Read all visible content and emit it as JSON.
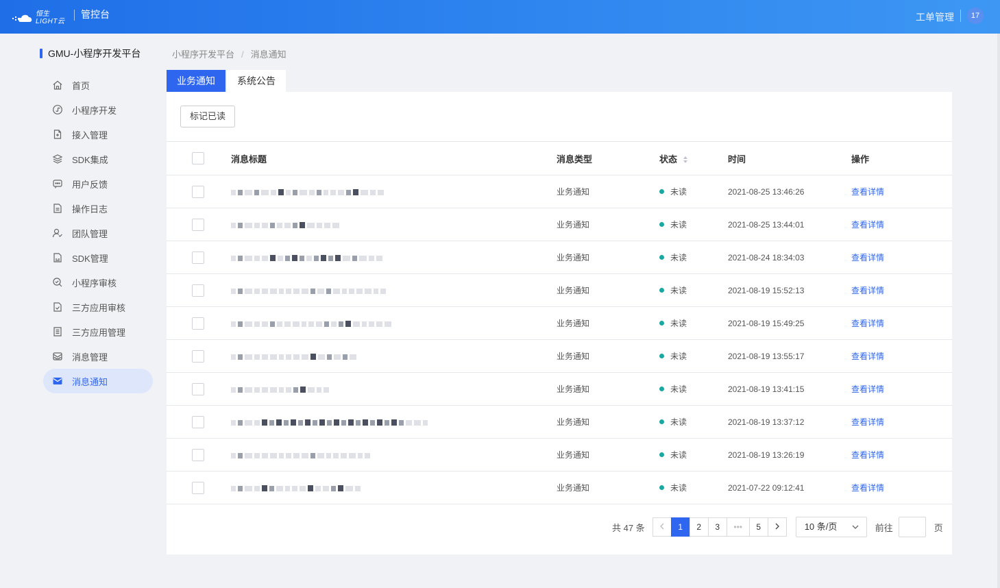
{
  "header": {
    "logo_text_top": "恒生",
    "logo_text_bottom": "LIGHT云",
    "app_title": "管控台",
    "ticket_link": "工单管理",
    "avatar_badge": "17"
  },
  "sidebar": {
    "title": "GMU-小程序开发平台",
    "items": [
      {
        "label": "首页",
        "icon": "home-icon"
      },
      {
        "label": "小程序开发",
        "icon": "miniprogram-icon"
      },
      {
        "label": "接入管理",
        "icon": "access-icon"
      },
      {
        "label": "SDK集成",
        "icon": "layers-icon"
      },
      {
        "label": "用户反馈",
        "icon": "chat-icon"
      },
      {
        "label": "操作日志",
        "icon": "log-icon"
      },
      {
        "label": "团队管理",
        "icon": "team-icon"
      },
      {
        "label": "SDK管理",
        "icon": "sdk-icon"
      },
      {
        "label": "小程序审核",
        "icon": "review-icon"
      },
      {
        "label": "三方应用审核",
        "icon": "check-doc-icon"
      },
      {
        "label": "三方应用管理",
        "icon": "list-doc-icon"
      },
      {
        "label": "消息管理",
        "icon": "message-box-icon"
      },
      {
        "label": "消息通知",
        "icon": "mail-icon",
        "active": true
      }
    ]
  },
  "breadcrumb": {
    "parent": "小程序开发平台",
    "separator": "/",
    "current": "消息通知"
  },
  "tabs": [
    {
      "label": "业务通知",
      "active": true
    },
    {
      "label": "系统公告",
      "active": false
    }
  ],
  "toolbar": {
    "mark_read_label": "标记已读"
  },
  "table": {
    "columns": [
      "消息标题",
      "消息类型",
      "状态",
      "时间",
      "操作"
    ],
    "rows": [
      {
        "type": "业务通知",
        "status": "未读",
        "time": "2021-08-25 13:46:26",
        "action": "查看详情"
      },
      {
        "type": "业务通知",
        "status": "未读",
        "time": "2021-08-25 13:44:01",
        "action": "查看详情"
      },
      {
        "type": "业务通知",
        "status": "未读",
        "time": "2021-08-24 18:34:03",
        "action": "查看详情"
      },
      {
        "type": "业务通知",
        "status": "未读",
        "time": "2021-08-19 15:52:13",
        "action": "查看详情"
      },
      {
        "type": "业务通知",
        "status": "未读",
        "time": "2021-08-19 15:49:25",
        "action": "查看详情"
      },
      {
        "type": "业务通知",
        "status": "未读",
        "time": "2021-08-19 13:55:17",
        "action": "查看详情"
      },
      {
        "type": "业务通知",
        "status": "未读",
        "time": "2021-08-19 13:41:15",
        "action": "查看详情"
      },
      {
        "type": "业务通知",
        "status": "未读",
        "time": "2021-08-19 13:37:12",
        "action": "查看详情"
      },
      {
        "type": "业务通知",
        "status": "未读",
        "time": "2021-08-19 13:26:19",
        "action": "查看详情"
      },
      {
        "type": "业务通知",
        "status": "未读",
        "time": "2021-07-22 09:12:41",
        "action": "查看详情"
      }
    ]
  },
  "pagination": {
    "total_label": "共 47 条",
    "pages": [
      "1",
      "2",
      "3",
      "•••",
      "5"
    ],
    "current_page": "1",
    "page_size": "10 条/页",
    "goto_label": "前往",
    "goto_unit": "页",
    "goto_value": ""
  },
  "colors": {
    "accent": "#2e66f0",
    "status_unread": "#1aa8a0",
    "header_gradient_start": "#1f6ee8",
    "header_gradient_end": "#3d97f3"
  }
}
